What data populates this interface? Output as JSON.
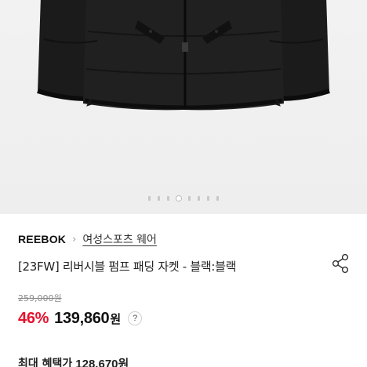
{
  "product": {
    "image": {
      "subject": "black padded jacket",
      "background_color": "#efefef"
    },
    "carousel": {
      "dot_count": 8,
      "active_index": 3
    },
    "brand": "REEBOK",
    "category": "여성스포츠 웨어",
    "title": "[23FW] 리버시블 펌프 패딩 자켓 - 블랙:블랙",
    "share_icon": "share-icon"
  },
  "pricing": {
    "original_price": "259,000원",
    "discount": "46%",
    "sale_price": "139,860",
    "currency": "원",
    "help_label": "?",
    "max_benefit_label": "최대 혜택가",
    "max_benefit_price": "128,670원",
    "discount_color": "#e8112d"
  }
}
